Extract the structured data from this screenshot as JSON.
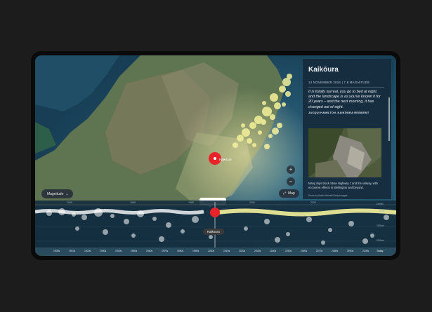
{
  "panel": {
    "title": "Kaikōura",
    "meta": "14 NOVEMBER 2016  |  7.8 MAGNITUDE",
    "quote": "It is totally surreal, you go to bed at night, and the landscape is as you've known it for 20 years – and the next morning, it has changed out of sight.",
    "attribution": "JACQUI HAMILTON, KAIKŌURA RESIDENT",
    "caption": "Many slips block State Highway 1 and the railway, with economic effects in Wellington and beyond.",
    "credit": "Photo by Mark Mitchell/Getty Images"
  },
  "controls": {
    "magnitude_label": "Magnitude",
    "map_label": "Map",
    "zoom_in": "+",
    "zoom_out": "−",
    "chevron": "⌄",
    "map_icon_glyph": "⤢"
  },
  "map": {
    "epicentre_label": "Kaikōura"
  },
  "timeline": {
    "selected_date": "14 Nov 2016",
    "selected_place": "Kaikōura",
    "depth_labels": [
      "Depth",
      "0km",
      "100km",
      "200km"
    ],
    "top_ticks": [
      "1940",
      "1960",
      "1980",
      "2000",
      "2020"
    ],
    "axis_ticks": [
      "1900s",
      "1910s",
      "1920s",
      "1930s",
      "1940s",
      "1950s",
      "1960s",
      "1970s",
      "1980s",
      "1990s",
      "2000s",
      "2010s",
      "2020s",
      "2030s",
      "2040s",
      "2050s",
      "2060s",
      "2070s",
      "2080s",
      "2090s",
      "2100s"
    ],
    "today_label": "Today"
  },
  "colors": {
    "accent_red": "#e8242a",
    "quake_yellow": "#f4f19a",
    "panel_bg": "#162c3e"
  }
}
